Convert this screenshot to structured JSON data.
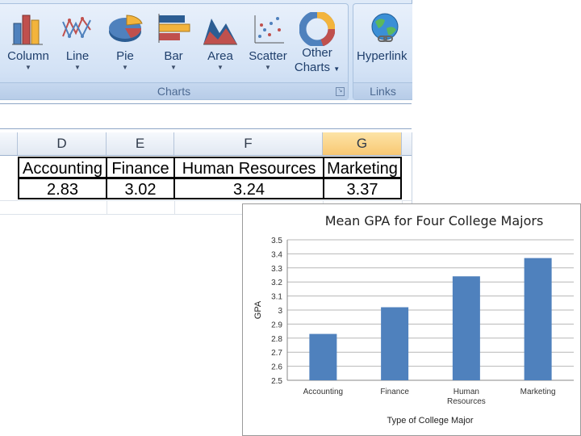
{
  "ribbon": {
    "charts_group_label": "Charts",
    "links_group_label": "Links",
    "buttons": [
      {
        "id": "column",
        "label": "Column"
      },
      {
        "id": "line",
        "label": "Line"
      },
      {
        "id": "pie",
        "label": "Pie"
      },
      {
        "id": "bar",
        "label": "Bar"
      },
      {
        "id": "area",
        "label": "Area"
      },
      {
        "id": "scatter",
        "label": "Scatter"
      },
      {
        "id": "other",
        "label_line1": "Other",
        "label_line2": "Charts"
      }
    ],
    "hyperlink_label": "Hyperlink"
  },
  "sheet": {
    "columns": [
      "D",
      "E",
      "F",
      "G"
    ],
    "active_column": "G",
    "headers": [
      "Accounting",
      "Finance",
      "Human Resources",
      "Marketing"
    ],
    "values": [
      "2.83",
      "3.02",
      "3.24",
      "3.37"
    ]
  },
  "chart_data": {
    "type": "bar",
    "title": "Mean GPA for Four College Majors",
    "xlabel": "Type of College Major",
    "ylabel": "GPA",
    "categories": [
      "Accounting",
      "Finance",
      "Human Resources",
      "Marketing"
    ],
    "category_lines": [
      [
        "Accounting"
      ],
      [
        "Finance"
      ],
      [
        "Human",
        "Resources"
      ],
      [
        "Marketing"
      ]
    ],
    "values": [
      2.83,
      3.02,
      3.24,
      3.37
    ],
    "ylim": [
      2.5,
      3.5
    ],
    "yticks": [
      "2.5",
      "2.6",
      "2.7",
      "2.8",
      "2.9",
      "3",
      "3.1",
      "3.2",
      "3.3",
      "3.4",
      "3.5"
    ],
    "grid": true,
    "legend": "none",
    "bar_color": "#4f81bd"
  }
}
